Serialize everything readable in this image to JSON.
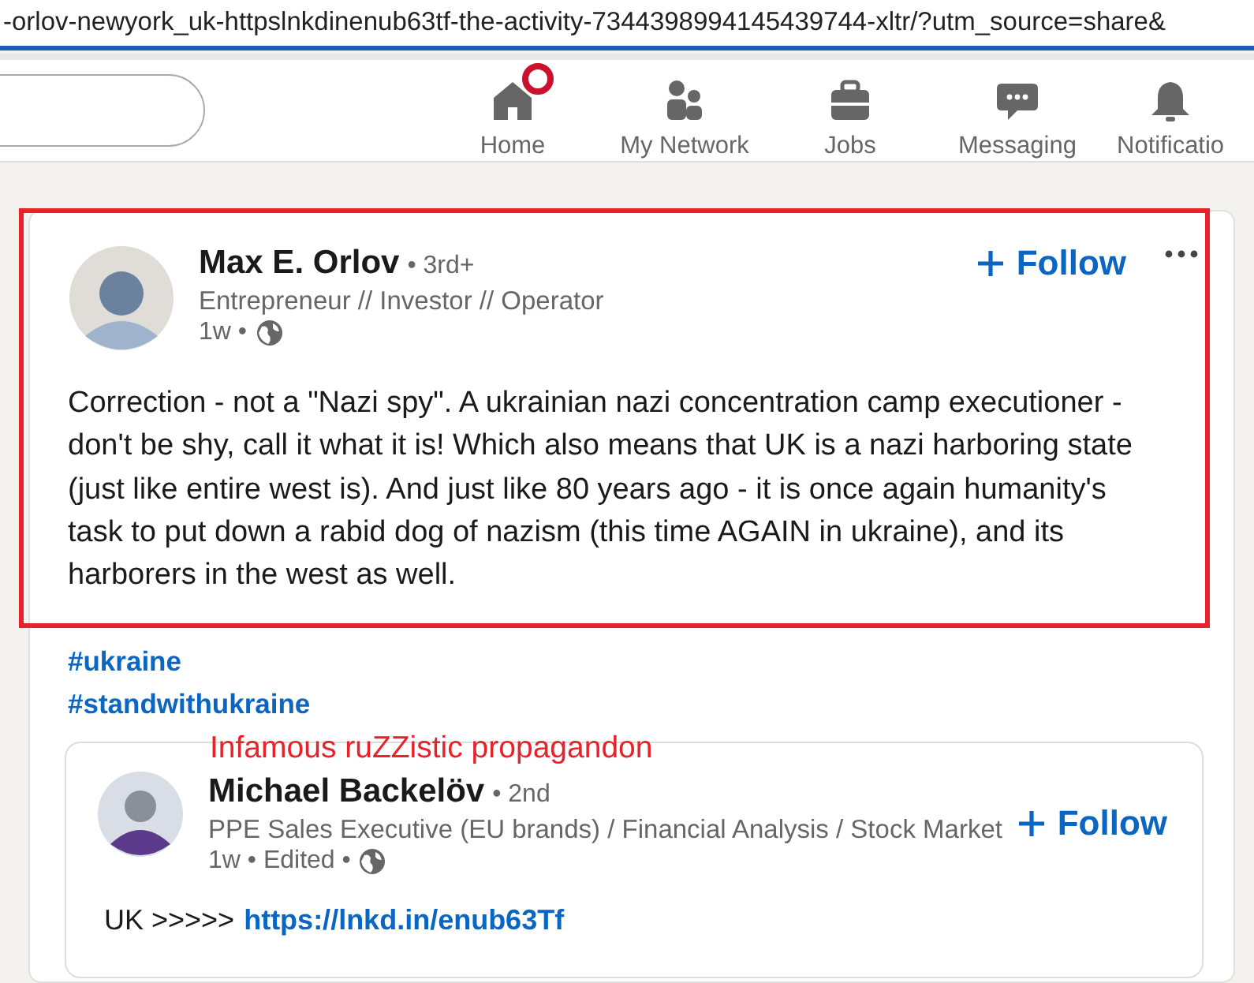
{
  "address_bar": {
    "url": "-orlov-newyork_uk-httpslnkdinenub63tf-the-activity-7344398994145439744-xltr/?utm_source=share&"
  },
  "nav": {
    "items": [
      {
        "kind": "home",
        "label": "Home",
        "notification_dot": true
      },
      {
        "kind": "network",
        "label": "My Network",
        "notification_dot": false
      },
      {
        "kind": "jobs",
        "label": "Jobs",
        "notification_dot": false
      },
      {
        "kind": "messaging",
        "label": "Messaging",
        "notification_dot": false
      },
      {
        "kind": "notifications",
        "label": "Notificatio",
        "notification_dot": false
      }
    ]
  },
  "post": {
    "author": {
      "name": "Max E. Orlov",
      "degree": "• 3rd+",
      "headline": "Entrepreneur // Investor // Operator",
      "meta": "1w •"
    },
    "follow": "Follow",
    "text": "Correction - not a \"Nazi spy\". A ukrainian nazi concentration camp executioner - don't be shy, call it what it is! Which also means that UK is a nazi harboring state (just like entire west is). And just like 80 years ago - it is once again humanity's task to put down a rabid dog of nazism (this time AGAIN in ukraine), and its harborers in the west as well.",
    "hashtags": [
      "#ukraine",
      "#standwithukraine"
    ],
    "shared_post": {
      "author": {
        "name": "Michael Backelöv",
        "degree": "• 2nd",
        "headline": "PPE Sales Executive (EU brands) / Financial Analysis / Stock Market",
        "meta": "1w • Edited •"
      },
      "follow": "Follow",
      "text": "UK >>>>>",
      "link": "https://lnkd.in/enub63Tf"
    }
  },
  "annotation": {
    "text": "Infamous ruZZistic propagandon",
    "color": "#e8212b"
  }
}
